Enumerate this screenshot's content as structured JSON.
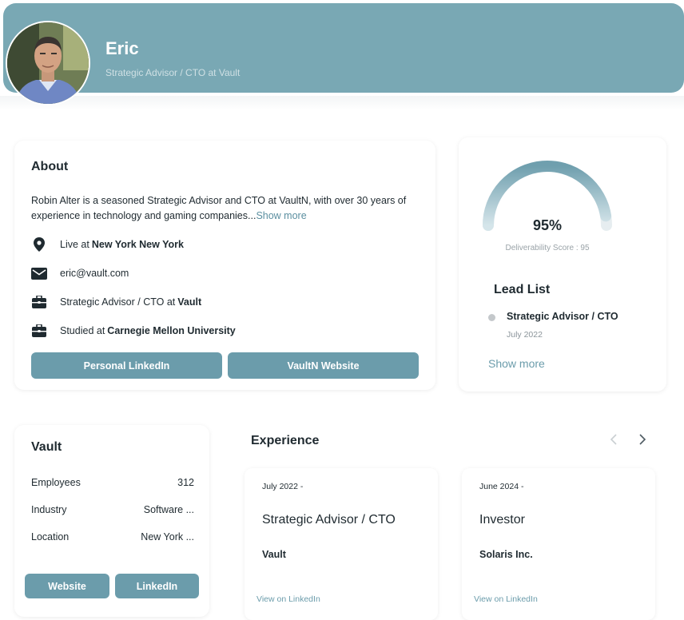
{
  "header": {
    "name": "Eric",
    "title": "Strategic Advisor / CTO at Vault"
  },
  "about": {
    "heading": "About",
    "bio": "Robin Alter is a seasoned Strategic Advisor and CTO at VaultN, with over 30 years of experience in technology and gaming companies...",
    "show_more": "Show more",
    "location_prefix": "Live at ",
    "location": "New York New York",
    "email": "eric@vault.com",
    "role_prefix": "Strategic Advisor / CTO at ",
    "role_company": "Vault",
    "education_prefix": "Studied at ",
    "education": "Carnegie Mellon University",
    "linkedin_button": "Personal LinkedIn",
    "website_button": "VaultN Website"
  },
  "score": {
    "percent_label": "95%",
    "value": 95,
    "caption": "Deliverability Score : 95",
    "accent": "#79a8b4"
  },
  "lead_list": {
    "heading": "Lead List",
    "items": [
      {
        "role": "Strategic Advisor / CTO",
        "date": "July 2022"
      }
    ],
    "show_more": "Show more"
  },
  "company": {
    "name": "Vault",
    "rows": [
      {
        "label": "Employees",
        "value": "312"
      },
      {
        "label": "Industry",
        "value": "Software ..."
      },
      {
        "label": "Location",
        "value": "New York ..."
      }
    ],
    "website_button": "Website",
    "linkedin_button": "LinkedIn"
  },
  "experience": {
    "heading": "Experience",
    "prev_icon": "chevron-left-icon",
    "next_icon": "chevron-right-icon",
    "items": [
      {
        "date": "July 2022 -",
        "role": "Strategic Advisor / CTO",
        "company": "Vault",
        "link": "View on LinkedIn"
      },
      {
        "date": "June 2024 -",
        "role": "Investor",
        "company": "Solaris Inc.",
        "link": "View on LinkedIn"
      }
    ]
  },
  "colors": {
    "header_bg": "#79a8b4",
    "button_bg": "#6b9cab"
  }
}
